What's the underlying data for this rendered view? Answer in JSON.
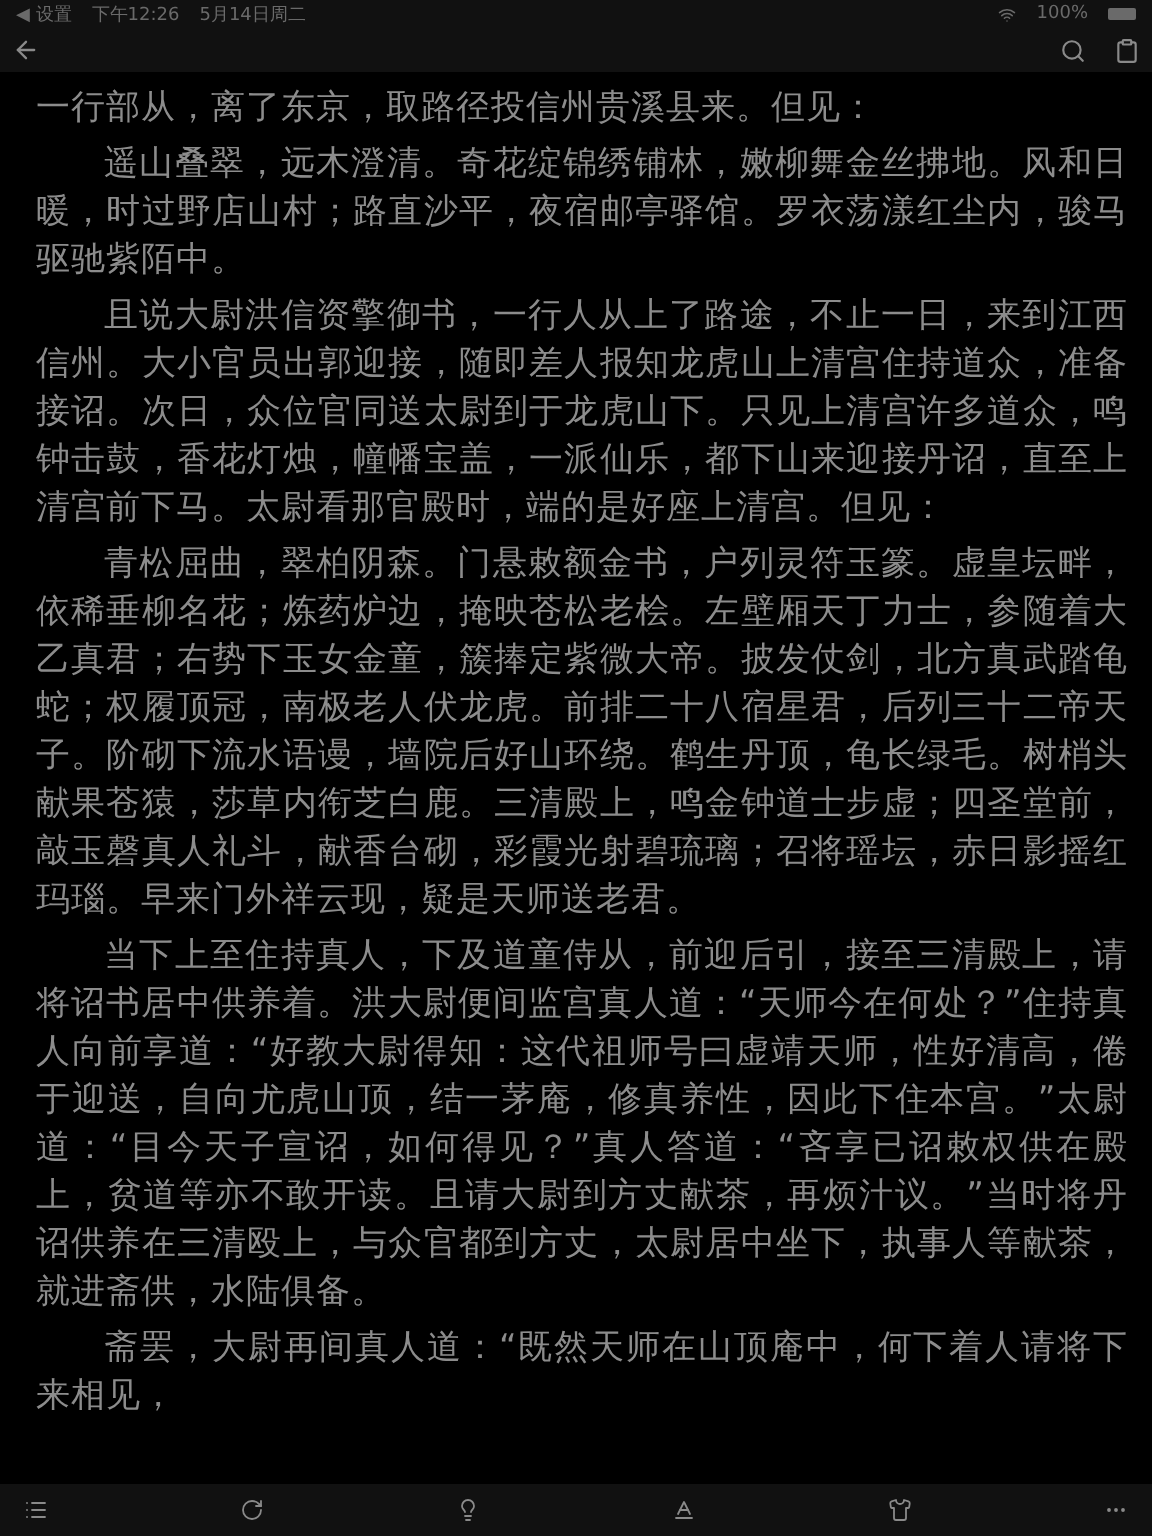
{
  "status_bar": {
    "back_app": "◀ 设置",
    "time": "下午12:26",
    "date": "5月14日周二",
    "battery": "100%"
  },
  "paragraphs": [
    {
      "indented": false,
      "text": "一行部从，离了东京，取路径投信州贵溪县来。但见："
    },
    {
      "indented": true,
      "text": "遥山叠翠，远木澄清。奇花绽锦绣铺林，嫩柳舞金丝拂地。风和日暖，时过野店山村；路直沙平，夜宿邮亭驿馆。罗衣荡漾红尘内，骏马驱驰紫陌中。"
    },
    {
      "indented": true,
      "text": "且说大尉洪信资擎御书，一行人从上了路途，不止一日，来到江西信州。大小官员出郭迎接，随即差人报知龙虎山上清宫住持道众，准备接诏。次日，众位官同送太尉到于龙虎山下。只见上清宫许多道众，鸣钟击鼓，香花灯烛，幢幡宝盖，一派仙乐，都下山来迎接丹诏，直至上清宫前下马。太尉看那官殿时，端的是好座上清宫。但见："
    },
    {
      "indented": true,
      "text": "青松屈曲，翠柏阴森。门悬敕额金书，户列灵符玉篆。虚皇坛畔，依稀垂柳名花；炼药炉边，掩映苍松老桧。左壁厢天丁力士，参随着大乙真君；右势下玉女金童，簇捧定紫微大帝。披发仗剑，北方真武踏龟蛇；权履顶冠，南极老人伏龙虎。前排二十八宿星君，后列三十二帝天子。阶砌下流水语谩，墙院后好山环绕。鹤生丹顶，龟长绿毛。树梢头献果苍猿，莎草内衔芝白鹿。三清殿上，鸣金钟道士步虚；四圣堂前，敲玉磬真人礼斗，献香台砌，彩霞光射碧琉璃；召将瑶坛，赤日影摇红玛瑙。早来门外祥云现，疑是天师送老君。"
    },
    {
      "indented": true,
      "text": "当下上至住持真人，下及道童侍从，前迎后引，接至三清殿上，请将诏书居中供养着。洪大尉便间监宫真人道：“天师今在何处？”住持真人向前享道：“好教大尉得知：这代祖师号曰虚靖天师，性好清高，倦于迎送，自向尤虎山顶，结一茅庵，修真养性，因此下住本宫。”太尉道：“目今天子宣诏，如何得见？”真人答道：“吝享已诏敕权供在殿上，贫道等亦不敢开读。且请大尉到方丈献茶，再烦汁议。”当时将丹诏供养在三清殴上，与众官都到方丈，太尉居中坐下，执事人等献茶，就进斋供，水陆俱备。"
    },
    {
      "indented": true,
      "text": "斋罢，大尉再间真人道：“既然天师在山顶庵中，何下着人请将下来相见，"
    }
  ]
}
